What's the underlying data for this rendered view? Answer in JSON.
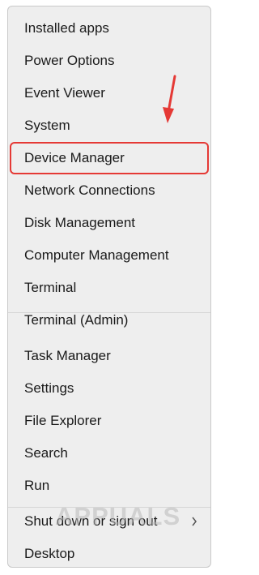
{
  "menu": {
    "items": [
      {
        "label": "Installed apps"
      },
      {
        "label": "Power Options"
      },
      {
        "label": "Event Viewer"
      },
      {
        "label": "System"
      },
      {
        "label": "Device Manager"
      },
      {
        "label": "Network Connections"
      },
      {
        "label": "Disk Management"
      },
      {
        "label": "Computer Management"
      },
      {
        "label": "Terminal"
      },
      {
        "label": "Terminal (Admin)"
      },
      {
        "label": "Task Manager"
      },
      {
        "label": "Settings"
      },
      {
        "label": "File Explorer"
      },
      {
        "label": "Search"
      },
      {
        "label": "Run"
      },
      {
        "label": "Shut down or sign out"
      },
      {
        "label": "Desktop"
      }
    ],
    "highlighted_item": "Device Manager"
  },
  "colors": {
    "highlight": "#e53935",
    "menu_bg": "#eeeeee"
  },
  "icons": {
    "submenu": "chevron-right-icon",
    "annotation": "red-arrow-icon"
  },
  "watermark": {
    "text": "APPUALS"
  }
}
